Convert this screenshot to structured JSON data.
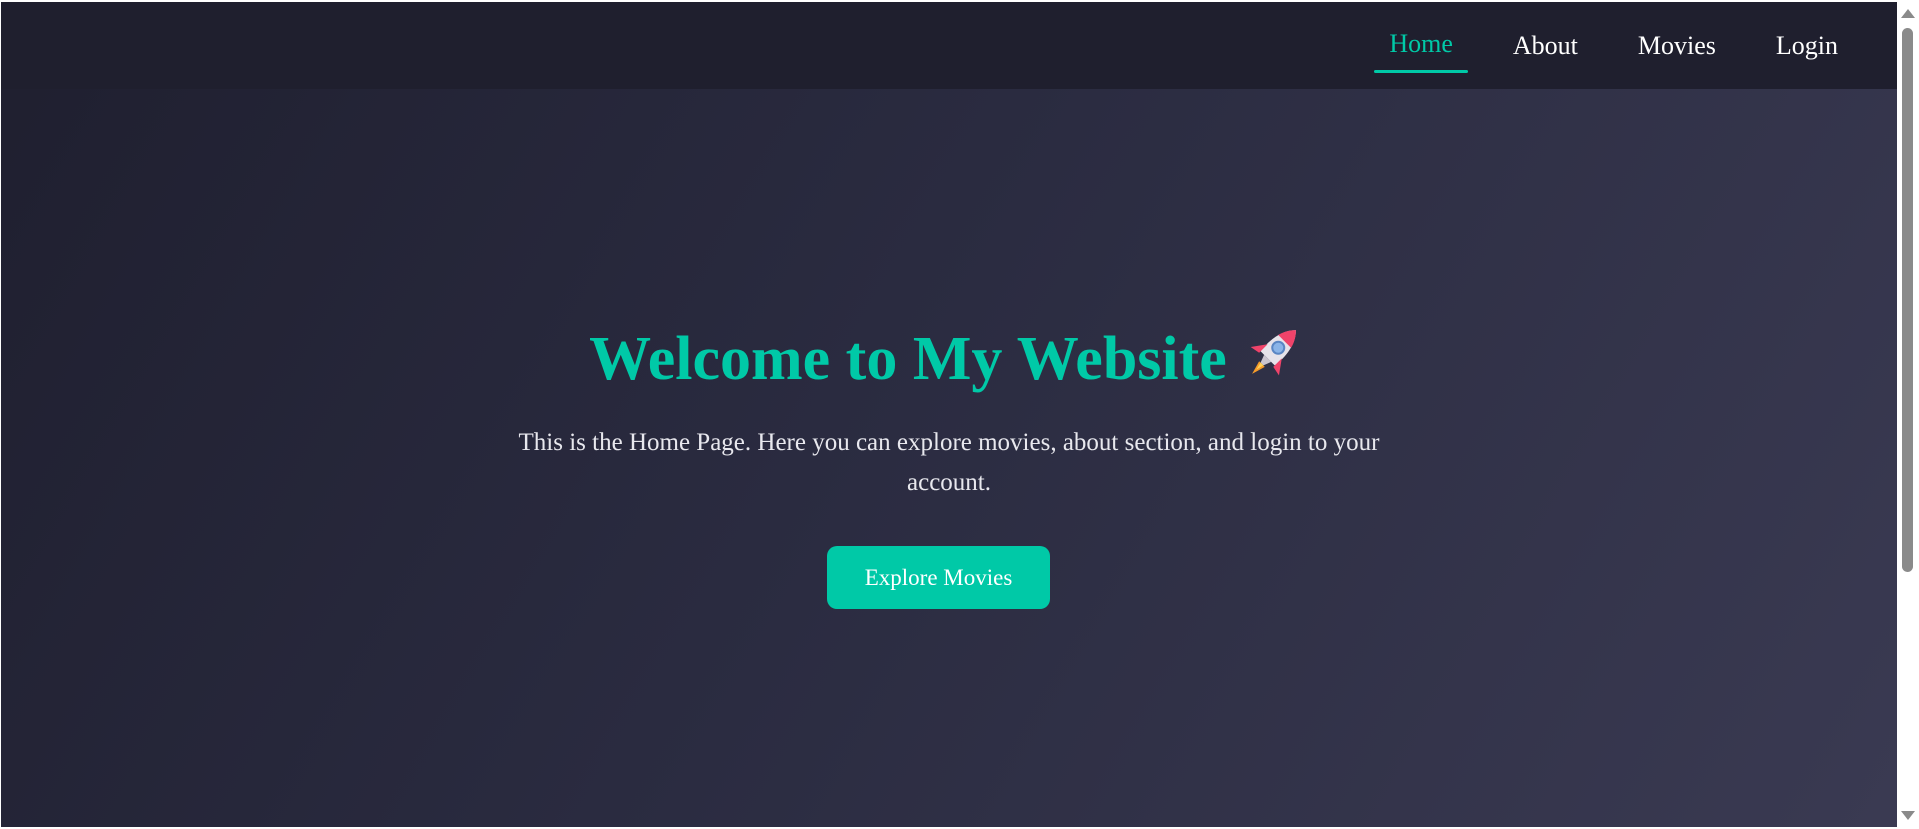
{
  "navbar": {
    "links": [
      {
        "label": "Home",
        "active": true
      },
      {
        "label": "About",
        "active": false
      },
      {
        "label": "Movies",
        "active": false
      },
      {
        "label": "Login",
        "active": false
      }
    ]
  },
  "hero": {
    "title": "Welcome to My Website",
    "title_icon": "rocket-icon",
    "subtitle": "This is the Home Page. Here you can explore movies, about section, and login to your account.",
    "cta_label": "Explore Movies"
  },
  "colors": {
    "accent": "#00c9a7",
    "navbar_bg": "#1f1f2e",
    "text": "#ffffff"
  }
}
